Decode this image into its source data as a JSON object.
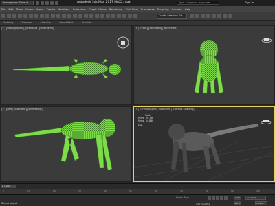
{
  "titlebar": {
    "workspace": "Workspaces: Default",
    "app_title": "Autodesk 3ds Max 2017      MAX2.max",
    "search_placeholder": "Type a keyword or phrase",
    "user": "Sign In"
  },
  "menu": [
    "File",
    "Edit",
    "Tools",
    "Group",
    "Views",
    "Create",
    "Modifiers",
    "Animation",
    "Graph Editors",
    "Rendering",
    "Civil View",
    "Customize",
    "Scripting",
    "Content",
    "Help"
  ],
  "toolbar": {
    "selection_set": "Create Selection Set"
  },
  "ribbon": [
    "Modeling",
    "Freeform",
    "Selection",
    "Object Paint",
    "Populate"
  ],
  "viewports": {
    "top": "[+] [Orthographic] [Standard] [Wireframe]",
    "front": "[+] [Front] [Standard] [Wireframe]",
    "left": "[+] [Left] [Standard] [Wireframe]",
    "perspective": "[+] [Orthographic] [Standard] [Default Shading]"
  },
  "stats": {
    "header": "Total",
    "polys_label": "Polys:",
    "polys": "29,796",
    "verts_label": "Verts:",
    "verts": "14,890",
    "fps_label": "FPS:"
  },
  "timeline": {
    "frame": "0 / 100",
    "ticks": [
      "0",
      "10",
      "20",
      "30",
      "40",
      "50",
      "60",
      "70",
      "80",
      "90",
      "100"
    ]
  },
  "status": {
    "message": "Select object",
    "coords": "Grid = 10,0",
    "add_time_tag": "Add Time Tag",
    "auto_key": "Auto",
    "set_key": "Set K.",
    "selected": "Selected",
    "filters": "Filters..."
  },
  "colors": {
    "wireframe": "#7ddc4a",
    "active_border": "#e8d060"
  }
}
